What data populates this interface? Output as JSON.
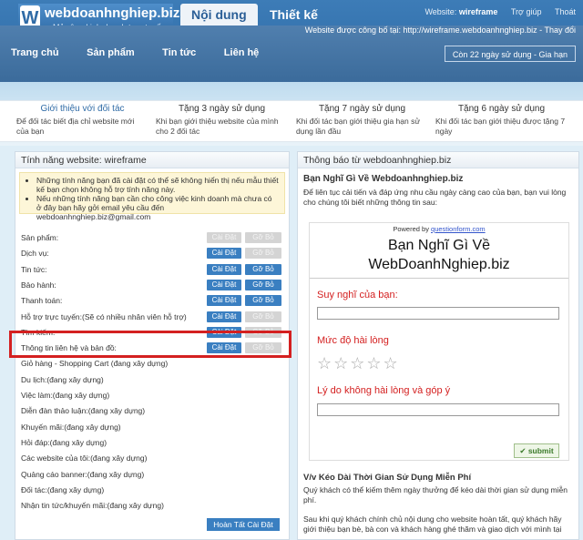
{
  "header": {
    "logo_mark": "W",
    "logo_name": "webdoanhnghiep.biz",
    "slogan": "Mở rộng kinh doanh trực tuyến",
    "tabs": [
      {
        "label": "Nội dung"
      },
      {
        "label": "Thiết kế"
      }
    ],
    "website_label": "Website:",
    "website_value": "wireframe",
    "help": "Trợ giúp",
    "logout": "Thoát",
    "site_info": "Website được công bố tại: http://wireframe.webdoanhnghiep.biz - Thay đổi",
    "nav": [
      "Trang chủ",
      "Sản phẩm",
      "Tin tức",
      "Liên hệ"
    ],
    "trial": "Còn 22 ngày sử dụng - Gia hạn"
  },
  "promos": [
    {
      "title": "Giới thiệu với đối tác",
      "desc": "Để đối tác biết địa chỉ website mới của bạn"
    },
    {
      "title": "Tặng 3 ngày sử dụng",
      "desc": "Khi bạn giới thiệu website của mình cho 2 đối tác"
    },
    {
      "title": "Tặng 7 ngày sử dụng",
      "desc": "Khi đối tác bạn giới thiệu gia hạn sử dụng lần đầu"
    },
    {
      "title": "Tặng 6 ngày sử dụng",
      "desc": "Khi đối tác bạn giới thiệu được tặng 7 ngày"
    }
  ],
  "features_panel": {
    "title": "Tính năng website: wireframe",
    "notice": [
      "Những tính năng bạn đã cài đặt có thể sẽ không hiển thị nếu mẫu thiết kế bạn chọn không hỗ trợ tính năng này.",
      "Nếu những tính năng bạn cần cho công việc kinh doanh mà chưa có ở đây bạn hãy gởi email yêu cầu đến webdoanhnghiep.biz@gmail.com"
    ],
    "install_label": "Cài Đặt",
    "remove_label": "Gỡ Bỏ",
    "rows": [
      {
        "label": "Sản phẩm:",
        "installed": false,
        "buttons": true
      },
      {
        "label": "Dịch vụ:",
        "installed": true,
        "buttons": true
      },
      {
        "label": "Tin tức:",
        "installed": true,
        "buttons": true
      },
      {
        "label": "Bảo hành:",
        "installed": true,
        "buttons": true
      },
      {
        "label": "Thanh toán:",
        "installed": true,
        "buttons": true
      },
      {
        "label": "Hỗ trợ trực tuyến:(Sẽ có nhiều nhân viên hỗ trợ)",
        "installed": true,
        "buttons": true
      },
      {
        "label": "Tìm kiếm:",
        "installed": true,
        "buttons": true
      },
      {
        "label": "Thông tin liên hệ và bản đồ:",
        "installed": true,
        "buttons": true
      },
      {
        "label": "Giỏ hàng - Shopping Cart (đang xây dựng)",
        "installed": false,
        "buttons": false
      },
      {
        "label": "Du lịch:(đang xây dựng)",
        "installed": false,
        "buttons": false
      },
      {
        "label": "Việc làm:(đang xây dựng)",
        "installed": false,
        "buttons": false
      },
      {
        "label": "Diễn đàn thảo luận:(đang xây dựng)",
        "installed": false,
        "buttons": false
      },
      {
        "label": "Khuyến mãi:(đang xây dựng)",
        "installed": false,
        "buttons": false
      },
      {
        "label": "Hỏi đáp:(đang xây dựng)",
        "installed": false,
        "buttons": false
      },
      {
        "label": "Các website của tôi:(đang xây dựng)",
        "installed": false,
        "buttons": false
      },
      {
        "label": "Quảng cáo banner:(đang xây dựng)",
        "installed": false,
        "buttons": false
      },
      {
        "label": "Đối tác:(đang xây dựng)",
        "installed": false,
        "buttons": false
      },
      {
        "label": "Nhận tin tức/khuyến mãi:(đang xây dựng)",
        "installed": false,
        "buttons": false
      }
    ],
    "finish": "Hoàn Tất Cài Đặt"
  },
  "announce_panel": {
    "title": "Thông báo từ webdoanhnghiep.biz",
    "heading": "Bạn Nghĩ Gì Về Webdoanhnghiep.biz",
    "desc": "Để liên tục cải tiến và đáp ứng nhu cầu ngày càng cao của bạn, bạn vui lòng cho chúng tôi biết những thông tin sau:",
    "survey": {
      "powered": "Powered by",
      "powered_link": "questionform.com",
      "title_line1": "Bạn Nghĩ Gì Về",
      "title_line2": "WebDoanhNghiep.biz",
      "q1": "Suy nghĩ của bạn:",
      "q2": "Mức độ hài lòng",
      "q3": "Lý do không hài lòng và góp ý",
      "submit": "submit"
    },
    "heading2": "V/v Kéo Dài Thời Gian Sử Dụng Miễn Phí",
    "desc2": "Quý khách có thể kiếm thêm ngày thưởng để kéo dài thời gian sử dụng miễn phí.",
    "desc3": "Sau khi quý khách chính chủ nội dung cho website hoàn tất, quý khách hãy giới thiệu bạn bè, bà con và khách hàng ghé thăm và giao dịch với mình tại"
  }
}
